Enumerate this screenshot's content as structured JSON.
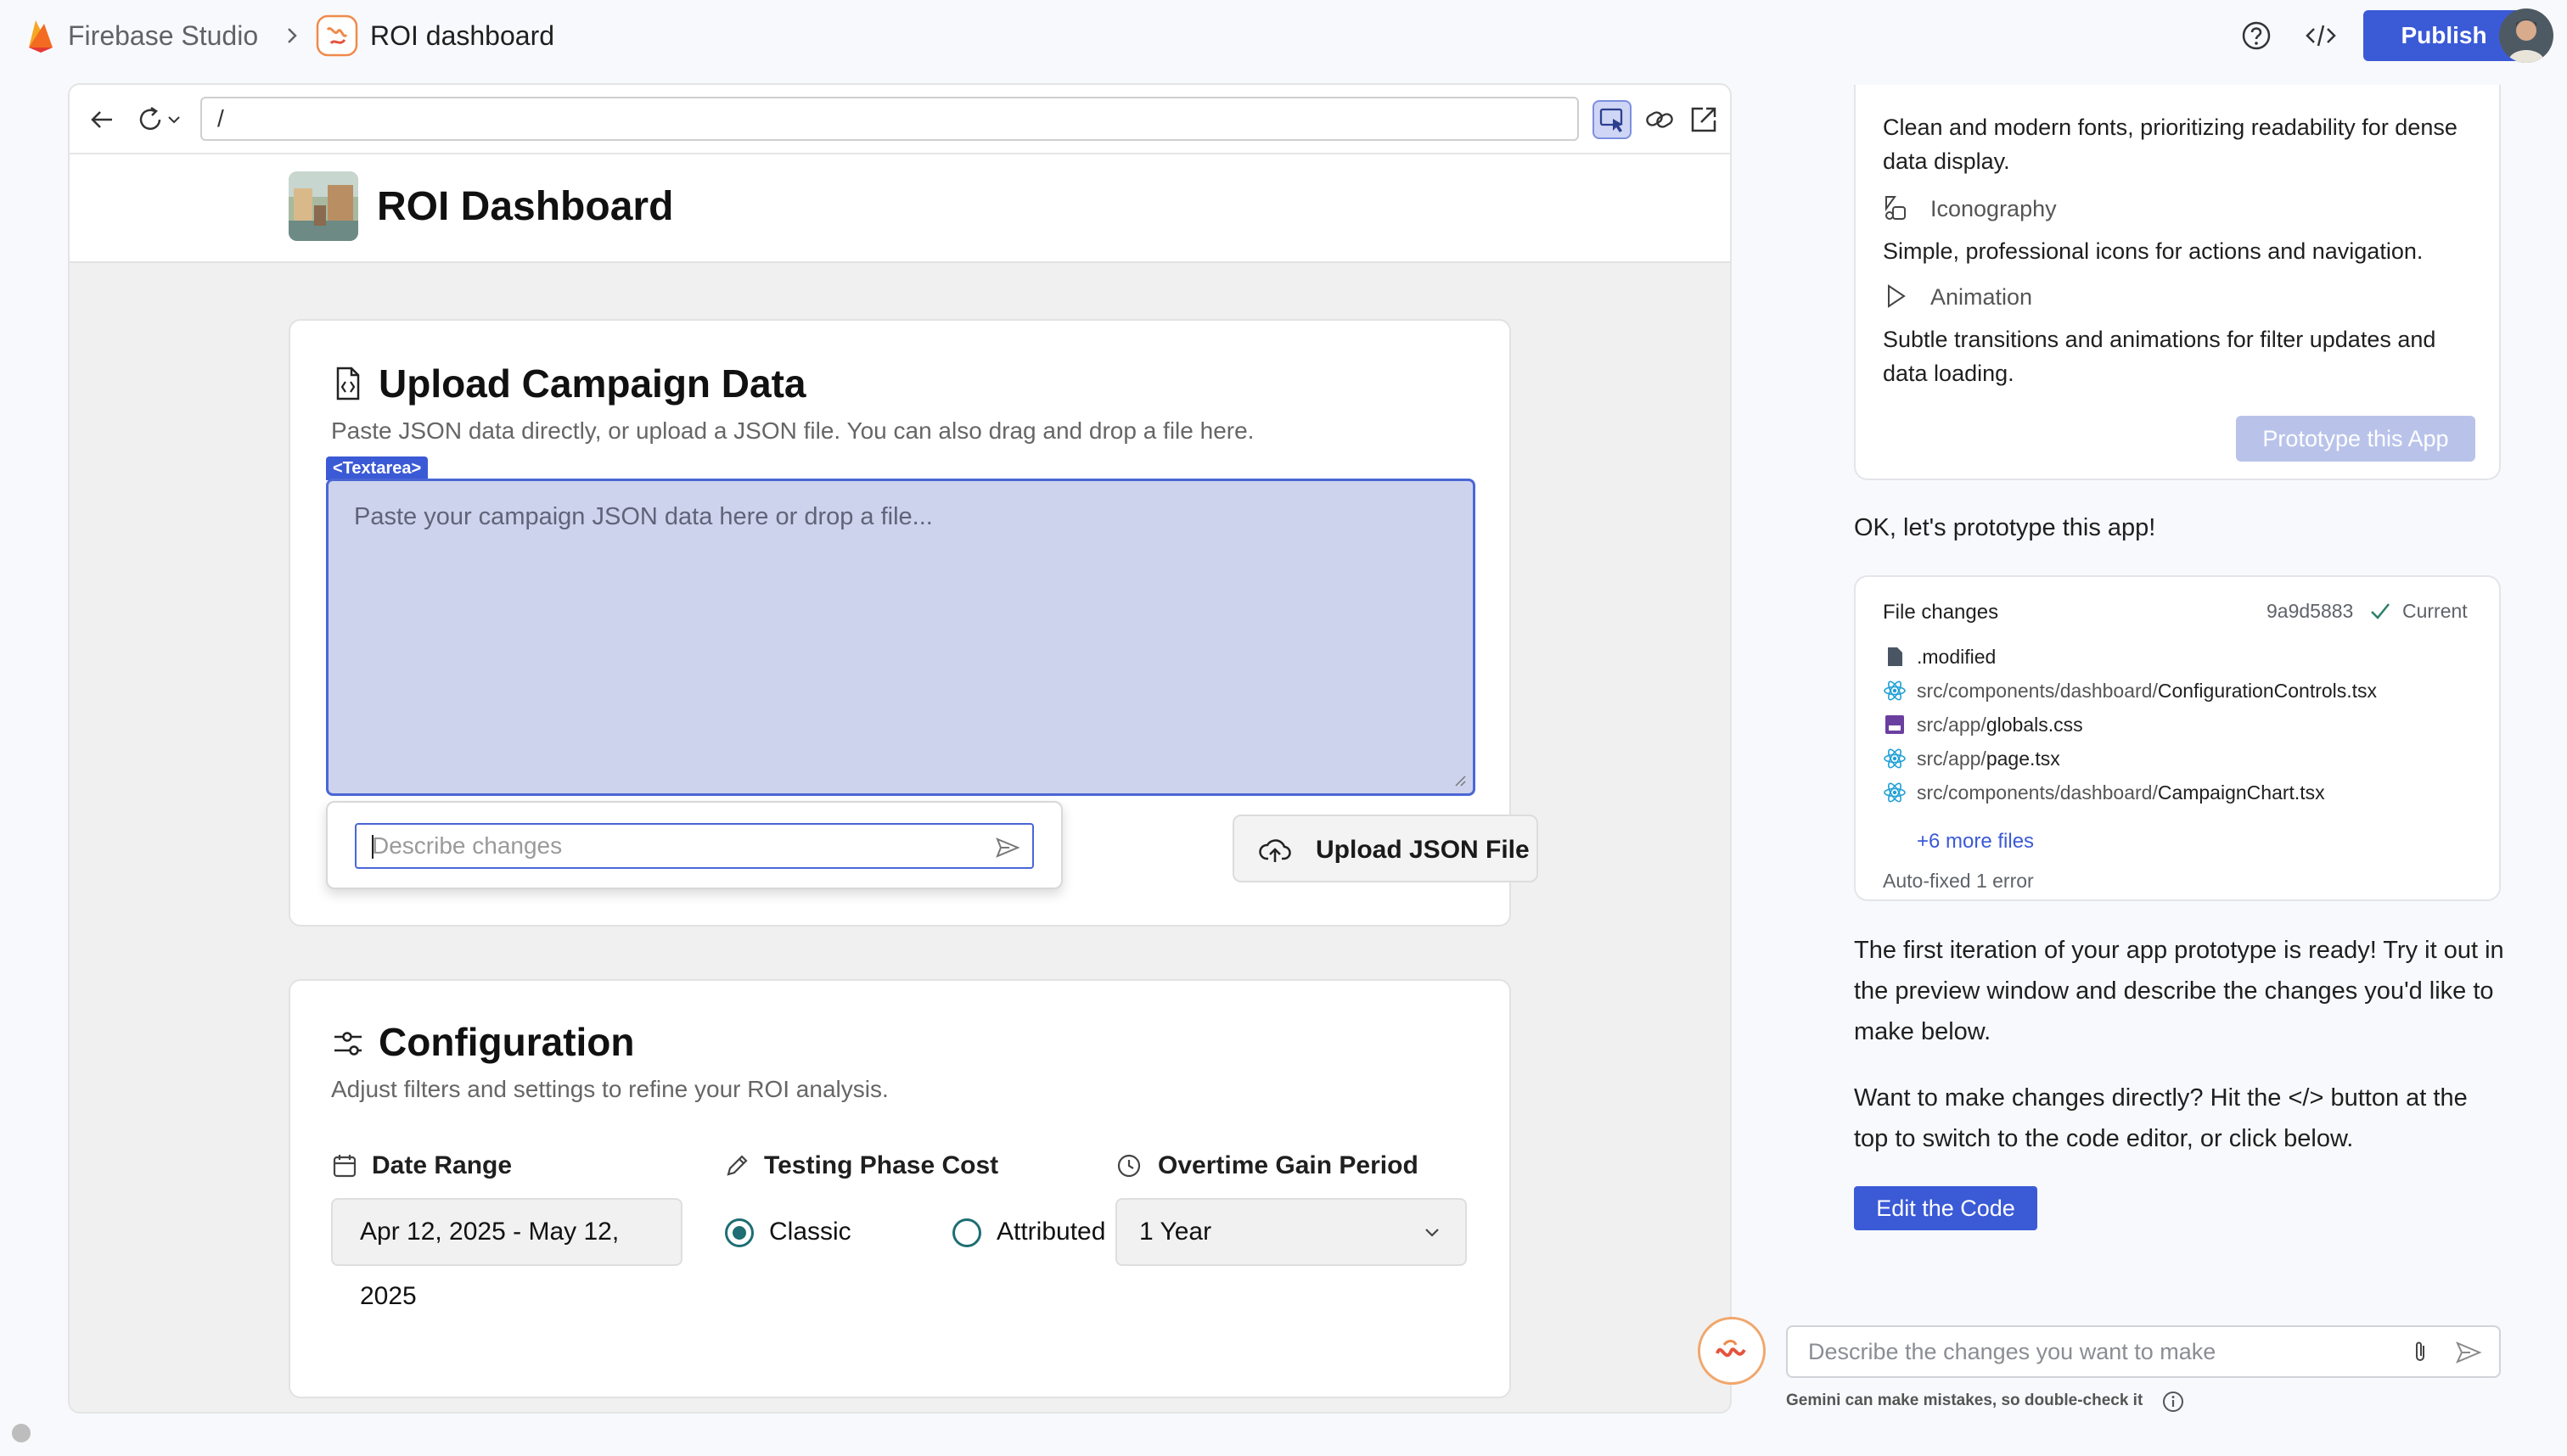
{
  "topbar": {
    "brand": "Firebase Studio",
    "project": "ROI dashboard",
    "publish_label": "Publish"
  },
  "browser": {
    "url": "/"
  },
  "app": {
    "title": "ROI Dashboard",
    "upload": {
      "title": "Upload Campaign Data",
      "description": "Paste JSON data directly, or upload a JSON file. You can also drag and drop a file here.",
      "element_tag": "<Textarea>",
      "textarea_placeholder": "Paste your campaign JSON data here or drop a file...",
      "describe_placeholder": "Describe changes",
      "upload_button": "Upload JSON File"
    },
    "config": {
      "title": "Configuration",
      "description": "Adjust filters and settings to refine your ROI analysis.",
      "date_label": "Date Range",
      "date_value": "Apr 12, 2025 - May 12, 2025",
      "cost_label": "Testing Phase Cost",
      "cost_options": [
        "Classic",
        "Attributed"
      ],
      "cost_selected": "Classic",
      "gain_label": "Overtime Gain Period",
      "gain_value": "1 Year"
    }
  },
  "chat": {
    "spec": {
      "typography_desc": "Clean and modern fonts, prioritizing readability for dense data display.",
      "iconography_label": "Iconography",
      "iconography_desc": "Simple, professional icons for actions and navigation.",
      "animation_label": "Animation",
      "animation_desc": "Subtle transitions and animations for filter updates and data loading.",
      "prototype_button": "Prototype this App"
    },
    "ok_message": "OK, let's prototype this app!",
    "changes": {
      "title": "File changes",
      "commit": "9a9d5883",
      "status": "Current",
      "files": [
        {
          "dir": "",
          "name": ".modified",
          "type": "file"
        },
        {
          "dir": "src/components/dashboard/",
          "name": "ConfigurationControls.tsx",
          "type": "react"
        },
        {
          "dir": "src/app/",
          "name": "globals.css",
          "type": "css"
        },
        {
          "dir": "src/app/",
          "name": "page.tsx",
          "type": "react"
        },
        {
          "dir": "src/components/dashboard/",
          "name": "CampaignChart.tsx",
          "type": "react"
        }
      ],
      "more": "+6 more files",
      "autofixed": "Auto-fixed 1 error"
    },
    "ready_message": "The first iteration of your app prototype is ready! Try it out in the preview window and describe the changes you'd like to make below.",
    "direct_message": "Want to make changes directly? Hit the </> button at the top to switch to the code editor, or click below.",
    "edit_button": "Edit the Code",
    "input_placeholder": "Describe the changes you want to make",
    "disclaimer": "Gemini can make mistakes, so double-check it"
  },
  "colors": {
    "accent": "#3b5ad6",
    "radio": "#1e6e73",
    "textarea_highlight": "#cdd3ec"
  }
}
